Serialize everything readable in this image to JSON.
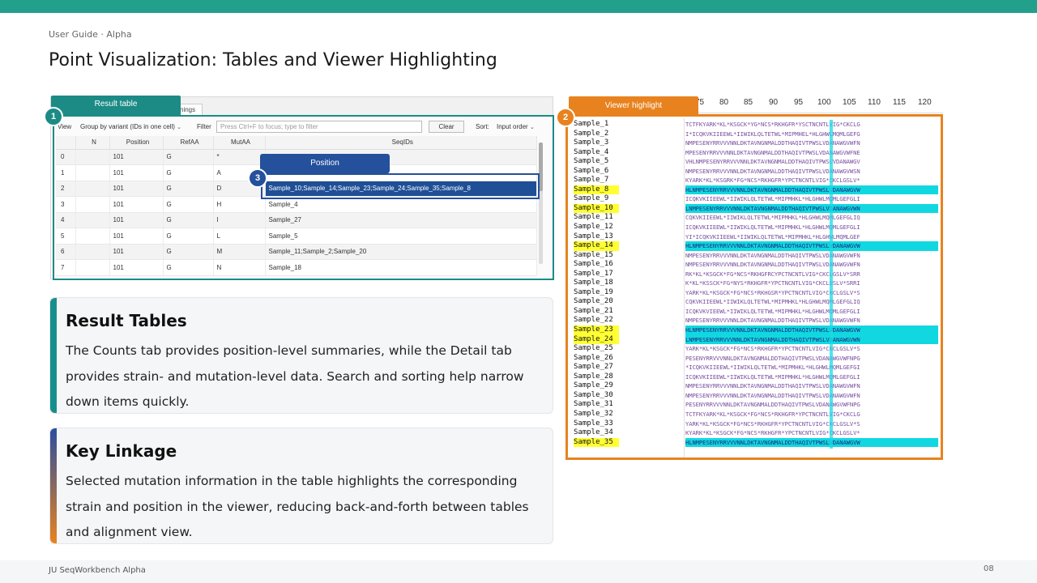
{
  "header": {
    "breadcrumb": "User Guide · Alpha",
    "title": "Point Visualization: Tables and Viewer Highlighting"
  },
  "callouts": {
    "result_table": "Result table",
    "position": "Position",
    "viewer_highlight": "Viewer highlight",
    "badge1": "1",
    "badge2": "2",
    "badge3": "3"
  },
  "table": {
    "tab_warnings": "nings",
    "view_label": "View",
    "group_select": "Group by variant (IDs in one cell)",
    "filter_label": "Filter",
    "filter_placeholder": "Press Ctrl+F to focus; type to filter",
    "clear_label": "Clear",
    "sort_label": "Sort:",
    "sort_select": "Input order",
    "columns": [
      "",
      "N",
      "Position",
      "RefAA",
      "MutAA",
      "SeqIDs"
    ],
    "rows": [
      {
        "i": "0",
        "n": "",
        "pos": "101",
        "ref": "G",
        "mut": "*",
        "ids": ""
      },
      {
        "i": "1",
        "n": "",
        "pos": "101",
        "ref": "G",
        "mut": "A",
        "ids": ""
      },
      {
        "i": "2",
        "n": "",
        "pos": "101",
        "ref": "G",
        "mut": "D",
        "ids": "Sample_10;Sample_14;Sample_23;Sample_24;Sample_35;Sample_8"
      },
      {
        "i": "3",
        "n": "",
        "pos": "101",
        "ref": "G",
        "mut": "H",
        "ids": "Sample_4"
      },
      {
        "i": "4",
        "n": "",
        "pos": "101",
        "ref": "G",
        "mut": "I",
        "ids": "Sample_27"
      },
      {
        "i": "5",
        "n": "",
        "pos": "101",
        "ref": "G",
        "mut": "L",
        "ids": "Sample_5"
      },
      {
        "i": "6",
        "n": "",
        "pos": "101",
        "ref": "G",
        "mut": "M",
        "ids": "Sample_11;Sample_2;Sample_20"
      },
      {
        "i": "7",
        "n": "",
        "pos": "101",
        "ref": "G",
        "mut": "N",
        "ids": "Sample_18"
      }
    ]
  },
  "viewer": {
    "ruler": [
      "75",
      "80",
      "85",
      "90",
      "95",
      "100",
      "105",
      "110",
      "115",
      "120"
    ],
    "highlighted": [
      "Sample_8",
      "Sample_10",
      "Sample_14",
      "Sample_23",
      "Sample_24",
      "Sample_35"
    ],
    "samples": [
      {
        "name": "Sample_1",
        "seq": "TCTFKYARK*KL*KSGCK*YG*NCS*RKHGFR*YSCTNCNTLVIG*CKCLG"
      },
      {
        "name": "Sample_2",
        "seq": "I*ICQKVKIIEEWL*IIWIKLQLTETWL*MIPMHEL*HLGHWLMQMLGEFG"
      },
      {
        "name": "Sample_3",
        "seq": "NMPESENYRRVVVNNLDKTAVNGNMALDDTHAQIVTPWSLVDANAWGVWFN"
      },
      {
        "name": "Sample_4",
        "seq": "MPESENYRRVVVNNLDKTAVNGNMALDDTHAQIVTPWSLVDANAWGVWFNE"
      },
      {
        "name": "Sample_5",
        "seq": "VHLNMPESENYRRVVVNNLDKTAVNGNMALDDTHAQIVTPWSLVDANAWGV"
      },
      {
        "name": "Sample_6",
        "seq": "NMPESENYRRVVVNNLDKTAVNGNMALDDTHAQIVTPWSLVDANAWGVWSN"
      },
      {
        "name": "Sample_7",
        "seq": "KYARK*KL*KSGRK*FG*NCS*RKHGFR*YPCTNCNTLVIG*CKCLGSLV*"
      },
      {
        "name": "Sample_8",
        "seq": "HLNMPESENYRRVVVNNLDKTAVNGNMALDDTHAQIVTPWSLVDANAWGVW"
      },
      {
        "name": "Sample_9",
        "seq": "ICQKVKIIEEWL*IIWIKLQLTETWL*MIPMHKL*HLGHWLMQMLGEFGLI"
      },
      {
        "name": "Sample_10",
        "seq": "LNMPESENYRRVVVNNLDKTAVNGNMALDDTHAQIVTPWSLVDANAWGVWN"
      },
      {
        "name": "Sample_11",
        "seq": "CQKVKIIEEWL*IIWIKLQLTETWL*MIPMHKL*HLGHWLMQMLGEFGLIQ"
      },
      {
        "name": "Sample_12",
        "seq": "ICQKVKIIEEWL*IIWIKLQLTETWL*MIPMHKL*HLGHWLMQMLGEFGLI"
      },
      {
        "name": "Sample_13",
        "seq": "YI*ICQKVKIIEEWL*IIWIKLQLTETWL*MIPMHKL*HLGHWLMQMLGEF"
      },
      {
        "name": "Sample_14",
        "seq": "HLNMPESENYRRVVVNNLDKTAVNGNMALDDTHAQIVTPWSLVDANAWGVW"
      },
      {
        "name": "Sample_15",
        "seq": "NMPESENYRRVVVNNLDKTAVNGNMALDDTHAQIVTPWSLVDANAWGVWFN"
      },
      {
        "name": "Sample_16",
        "seq": "NMPESENYRRVVVNNLDKTAVNGNMALDDTHAQIVTPWSLVDANAWGVWFN"
      },
      {
        "name": "Sample_17",
        "seq": "RK*KL*KSGCK*FG*NCS*RKHGFRCYPCTNCNTLVIG*CKCLGSLV*SRR"
      },
      {
        "name": "Sample_18",
        "seq": "K*KL*KSSCK*FG*NYS*RKHGFR*YPCTNCNTLVIG*CKCLGSLV*SRRI"
      },
      {
        "name": "Sample_19",
        "seq": "YARK*KL*KSGCK*FG*NCS*RKHGSR*YPCTNCNTLVIG*CKCLGSLV*S"
      },
      {
        "name": "Sample_20",
        "seq": "CQKVKIIEEWL*IIWIKLQLTETWL*MIPMHKL*HLGHWLMQMLGEFGLIQ"
      },
      {
        "name": "Sample_21",
        "seq": "ICQKVKVIEEWL*IIWIKLQLTETWL*MIPMHKL*HLGHWLMQMLGEFGLI"
      },
      {
        "name": "Sample_22",
        "seq": "NMPESENYRRVVVNNLDKTAVNGNMALDDTHAQIVTPWSLVDANAWGVWFN"
      },
      {
        "name": "Sample_23",
        "seq": "HLNMPESENYRRVVVNNLDKTAVNGNMALDDTHAQIVTPWSLVDANAWGVW"
      },
      {
        "name": "Sample_24",
        "seq": "LNMPESENYRRVVVNNLDKTAVNGNMALDDTHAQIVTPWSLVDANAWGVWN"
      },
      {
        "name": "Sample_25",
        "seq": "YARK*KL*KSGCK*FG*NCS*RKHGFR*YPCTNCNTLVIG*CKCLGSLV*S"
      },
      {
        "name": "Sample_26",
        "seq": "PESENYRRVVVNNLDKTAVNGNMALDDTHAQIVTPWSLVDANAWGVWFNPG"
      },
      {
        "name": "Sample_27",
        "seq": "*ICQKVKIIEEWL*IIWIKLQLTETWL*MIPMHKL*HLGHWLMQMLGEFGI"
      },
      {
        "name": "Sample_28",
        "seq": "ICQKVKIIEEWL*IIWIKLQLTETWL*MIPMHKL*HLGHWLMQMLGEFGLI"
      },
      {
        "name": "Sample_29",
        "seq": "NMPESENYRRVVVNNLDKTAVNGNMALDDTHAQIVTPWSLVDANAWGVWFN"
      },
      {
        "name": "Sample_30",
        "seq": "NMPESENYRRVVVNNLDKTAVNGNMALDDTHAQIVTPWSLVDANAWGVWFN"
      },
      {
        "name": "Sample_31",
        "seq": "PESENYRRVVVNNLDKTAVNGNMALDDTHAQIVTPWSLVDANAWGVWFNPG"
      },
      {
        "name": "Sample_32",
        "seq": "TCTFKYARK*KL*KSGCK*FG*NCS*RKHGFR*YPCTNCNTLVIG*CKCLG"
      },
      {
        "name": "Sample_33",
        "seq": "YARK*KL*KSGCK*FG*NCS*RKHGFR*YPCTNCNTLVIG*CKCLGSLV*S"
      },
      {
        "name": "Sample_34",
        "seq": "KYARK*KL*KSGCK*FG*NCS*RKHGFR*YPCTNCNTLVIG*CKCLGSLV*"
      },
      {
        "name": "Sample_35",
        "seq": "HLNMPESENYRRVVVNNLDKTAVNGNMALDDTHAQIVTPWSLVDANAWGVW"
      }
    ]
  },
  "cards": [
    {
      "title": "Result Tables",
      "body": "The Counts tab provides position-level summaries, while the Detail tab provides strain- and mutation-level data. Search and sorting help narrow down items quickly."
    },
    {
      "title": "Key Linkage",
      "body": "Selected mutation information in the table highlights the corresponding strain and position in the viewer, reducing back-and-forth between tables and alignment view."
    }
  ],
  "footer": {
    "left": "JU SeqWorkbench Alpha",
    "page": "08"
  },
  "colors": {
    "teal": "#1c8b86",
    "blue": "#24509c",
    "orange": "#e8821e",
    "highlight_yellow": "#ffff33",
    "highlight_cyan": "#11d8e0"
  }
}
